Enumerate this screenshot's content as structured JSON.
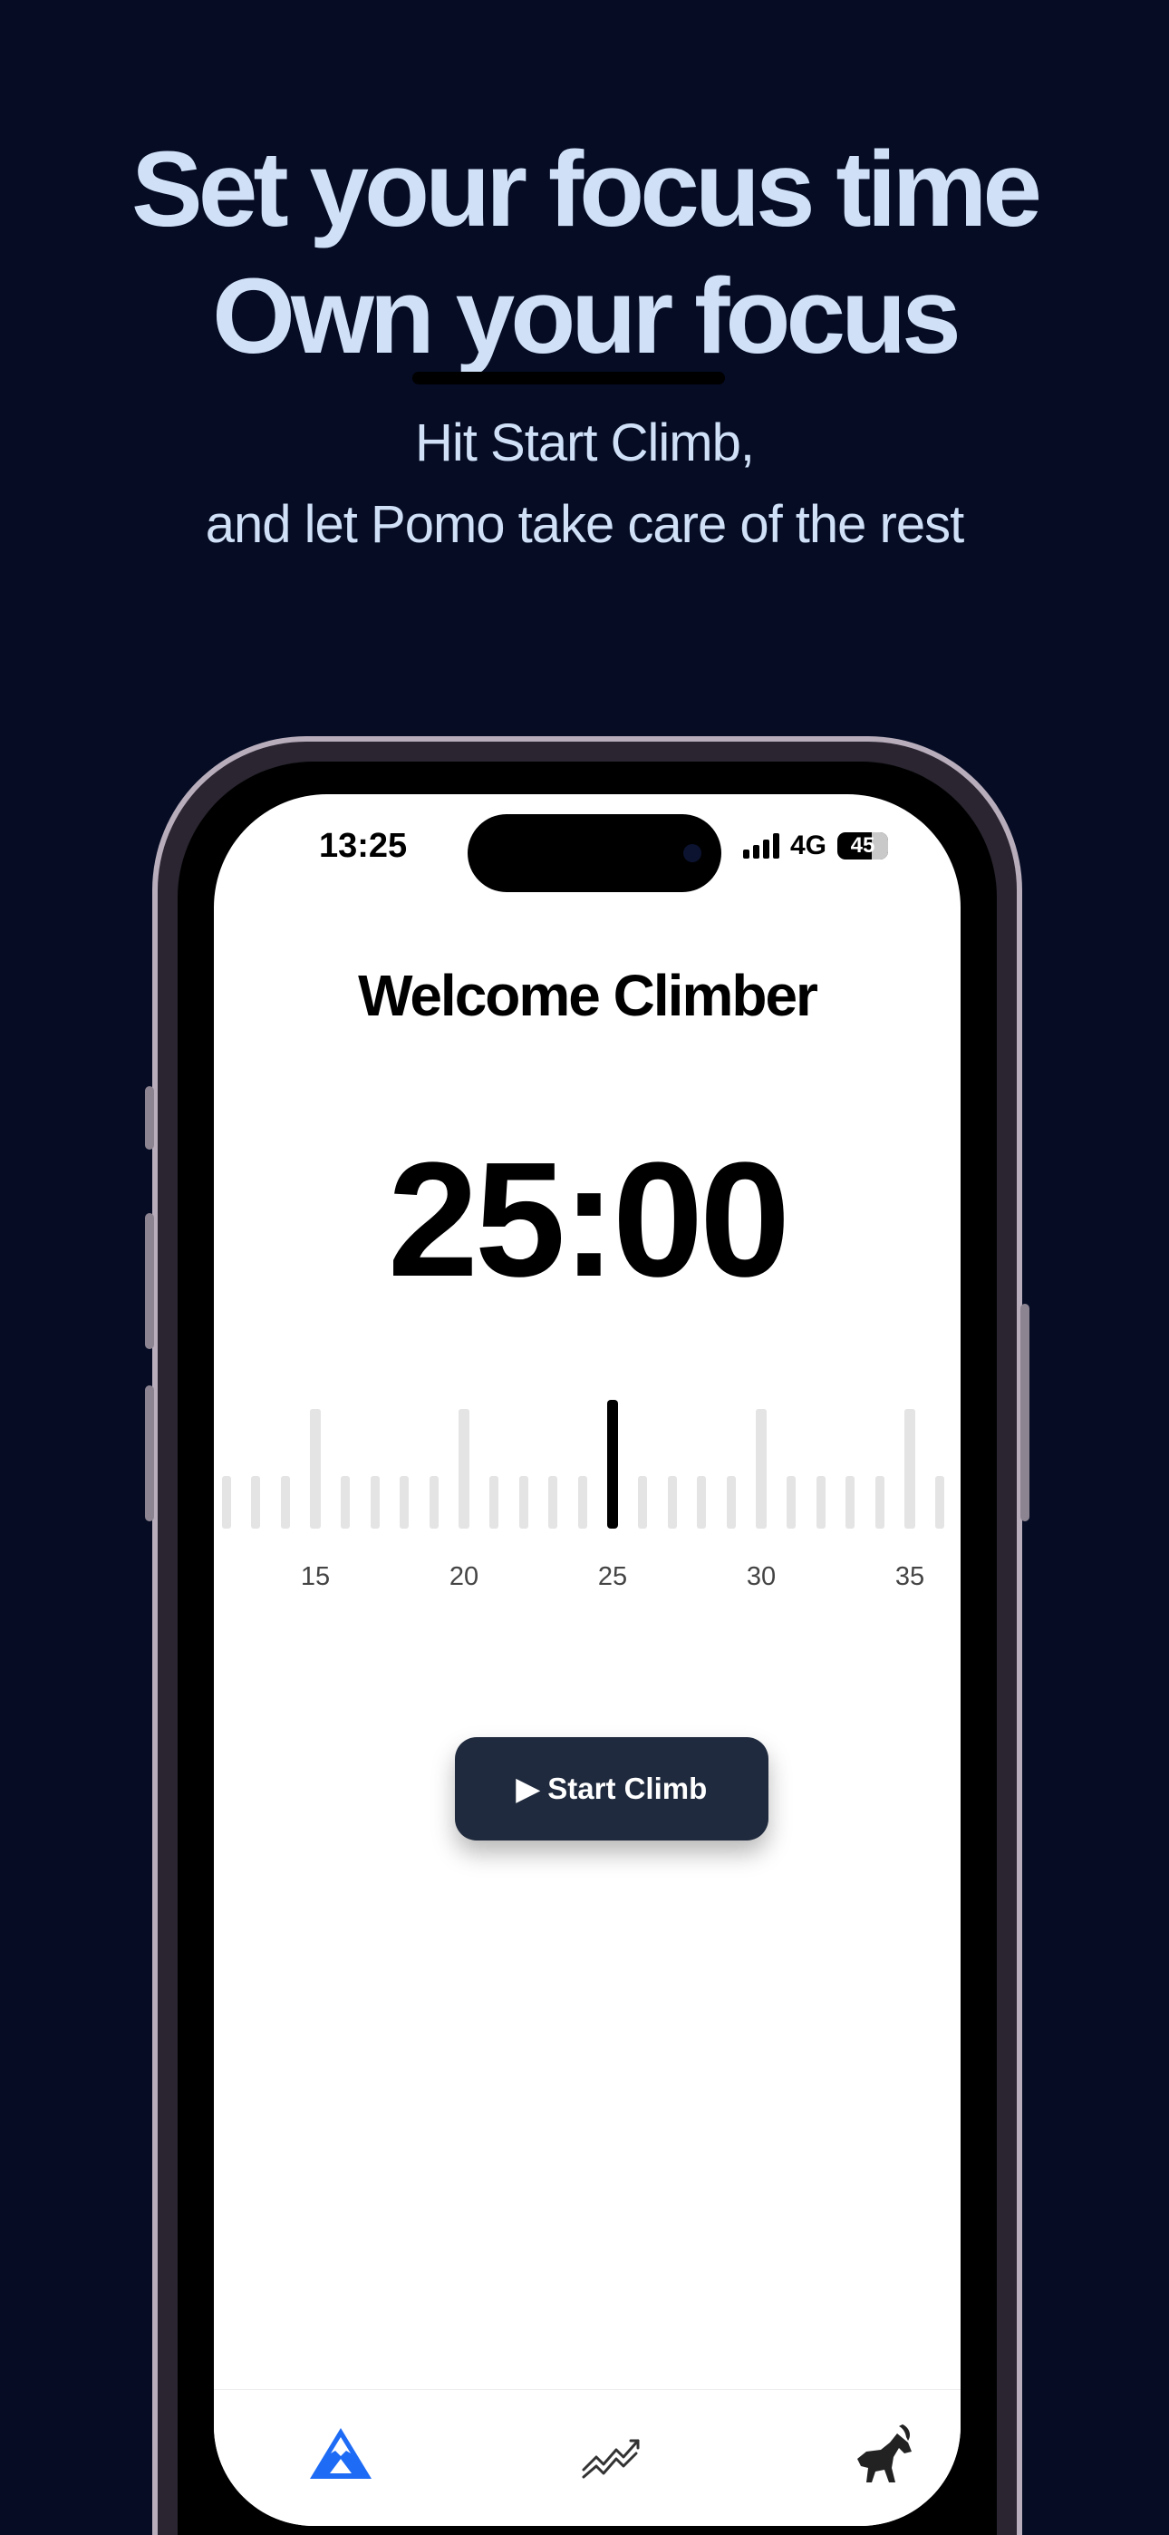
{
  "promo": {
    "headline_1": "Set your focus time",
    "headline_2": "Own your focus",
    "subline_1": "Hit Start Climb,",
    "subline_2": "and let Pomo take care of the rest"
  },
  "status_bar": {
    "time": "13:25",
    "network": "4G",
    "battery": "45"
  },
  "app": {
    "welcome": "Welcome Climber",
    "timer": "25:00",
    "selected_minutes": 25,
    "ruler_labels": [
      "15",
      "20",
      "25",
      "30",
      "35"
    ],
    "start_button": "▶ Start Climb"
  },
  "tabs": [
    {
      "icon": "mountain-icon",
      "active": true
    },
    {
      "icon": "trend-chart-icon",
      "active": false
    },
    {
      "icon": "goat-icon",
      "active": false
    }
  ],
  "colors": {
    "background": "#050c24",
    "headline": "#cfe0f7",
    "button": "#1f2a3e",
    "active_tab": "#1e6bf5"
  }
}
